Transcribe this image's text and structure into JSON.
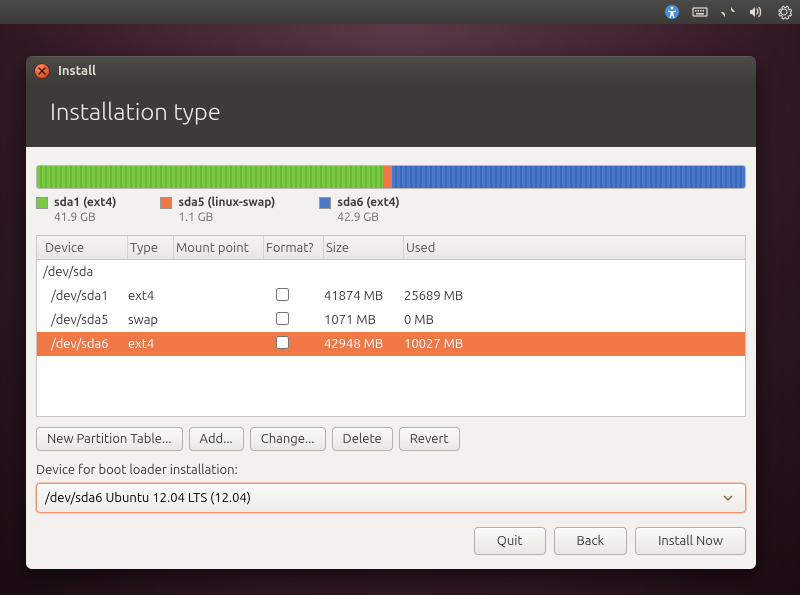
{
  "panel": {
    "icons": [
      "accessibility",
      "keyboard",
      "network",
      "volume",
      "settings"
    ]
  },
  "window": {
    "title": "Install",
    "heading": "Installation type"
  },
  "partitions": {
    "bar": [
      {
        "color": "green",
        "percent": 48.8
      },
      {
        "color": "orange",
        "percent": 1.3
      },
      {
        "color": "blue",
        "percent": 49.9
      }
    ],
    "legend": [
      {
        "color": "green",
        "label": "sda1 (ext4)",
        "size": "41.9 GB"
      },
      {
        "color": "orange",
        "label": "sda5 (linux-swap)",
        "size": "1.1 GB"
      },
      {
        "color": "blue",
        "label": "sda6 (ext4)",
        "size": "42.9 GB"
      }
    ]
  },
  "table": {
    "columns": [
      "Device",
      "Type",
      "Mount point",
      "Format?",
      "Size",
      "Used"
    ],
    "rows": [
      {
        "device": "/dev/sda",
        "type": "",
        "mount": "",
        "format": null,
        "size": "",
        "used": "",
        "child": false,
        "selected": false
      },
      {
        "device": "/dev/sda1",
        "type": "ext4",
        "mount": "",
        "format": false,
        "size": "41874 MB",
        "used": "25689 MB",
        "child": true,
        "selected": false
      },
      {
        "device": "/dev/sda5",
        "type": "swap",
        "mount": "",
        "format": false,
        "size": "1071 MB",
        "used": "0 MB",
        "child": true,
        "selected": false
      },
      {
        "device": "/dev/sda6",
        "type": "ext4",
        "mount": "",
        "format": false,
        "size": "42948 MB",
        "used": "10027 MB",
        "child": true,
        "selected": true
      }
    ]
  },
  "toolbar": {
    "new_partition_table": "New Partition Table...",
    "add": "Add...",
    "change": "Change...",
    "delete": "Delete",
    "revert": "Revert"
  },
  "bootloader": {
    "label": "Device for boot loader installation:",
    "value": "/dev/sda6  Ubuntu 12.04 LTS (12.04)"
  },
  "footer": {
    "quit": "Quit",
    "back": "Back",
    "install_now": "Install Now"
  }
}
